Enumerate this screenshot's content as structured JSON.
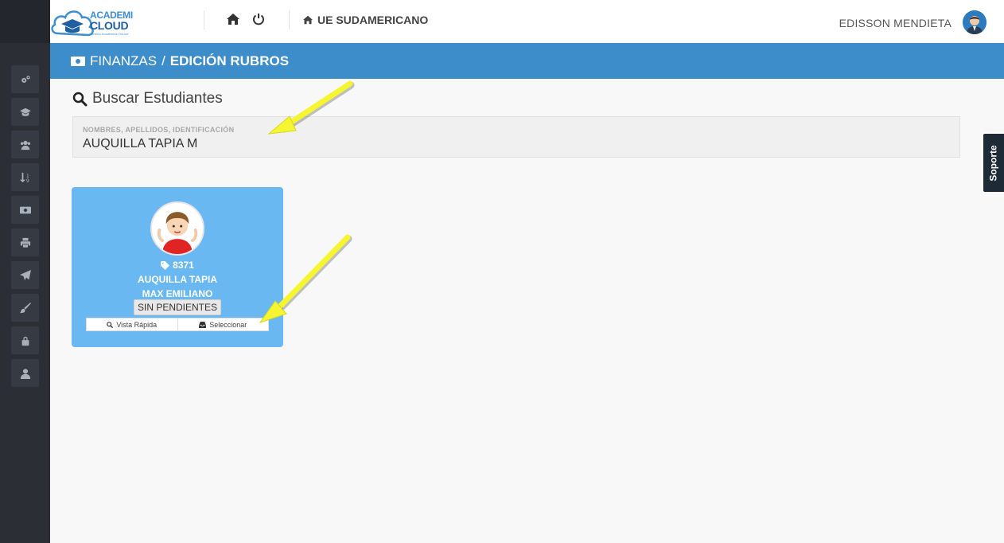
{
  "brand": {
    "line1": "ACADEMI",
    "line2": "CLOUD",
    "tagline": "Gestión Académica OnLine"
  },
  "topbar": {
    "school_name": "UE SUDAMERICANO",
    "user_name": "EDISSON MENDIETA"
  },
  "breadcrumb": {
    "section": "FINANZAS",
    "separator": "/",
    "page": "EDICIÓN RUBROS"
  },
  "search": {
    "title": "Buscar Estudiantes",
    "label": "NOMBRES, APELLIDOS, IDENTIFICACIÓN",
    "value": "AUQUILLA TAPIA M"
  },
  "support_tab": {
    "label": "Soporte"
  },
  "student_card": {
    "id": "8371",
    "surname": "AUQUILLA TAPIA",
    "given_names": "MAX EMILIANO",
    "status": "SIN PENDIENTES",
    "quick_view_label": "Vista Rápida",
    "select_label": "Seleccionar"
  },
  "colors": {
    "sidebar": "#2b2e35",
    "header_band": "#3c8dc9",
    "card": "#6ab8f1",
    "annotation_arrow": "#f5f532"
  }
}
